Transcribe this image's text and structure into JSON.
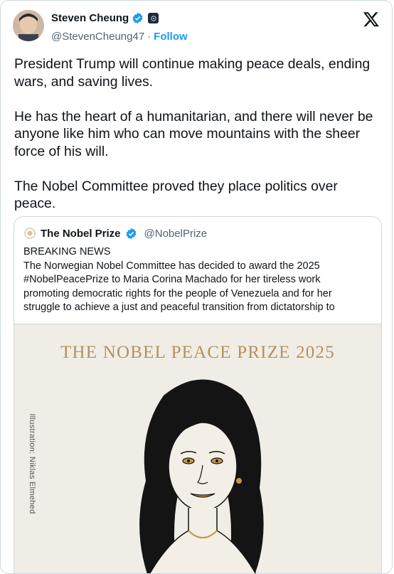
{
  "author": {
    "name": "Steven Cheung",
    "handle": "@StevenCheung47",
    "separator": "·",
    "follow_label": "Follow"
  },
  "tweet": {
    "paragraphs": [
      "President Trump will continue making peace deals, ending wars, and saving lives.",
      "He has the heart of a humanitarian, and there will never be anyone like him who can move mountains with the sheer force of his will.",
      "The Nobel Committee proved they place politics over peace."
    ]
  },
  "quote": {
    "name": "The Nobel Prize",
    "handle": "@NobelPrize",
    "lines": [
      "BREAKING NEWS",
      "The Norwegian Nobel Committee has decided to award the 2025",
      "#NobelPeacePrize to Maria Corina Machado for her tireless work",
      "promoting democratic rights for the people of Venezuela and for her",
      "struggle to achieve a just and peaceful transition from dictatorship to"
    ],
    "image": {
      "title": "THE NOBEL PEACE PRIZE 2025",
      "credit": "Illustration: Niklas Elmehed"
    }
  },
  "colors": {
    "link": "#1d9bf0",
    "verified": "#1d9bf0",
    "gold": "#b8905a",
    "muted": "#536471"
  },
  "icons": {
    "verified": "verified-badge-icon",
    "affiliate": "affiliate-badge-icon",
    "platform": "x-logo-icon"
  }
}
